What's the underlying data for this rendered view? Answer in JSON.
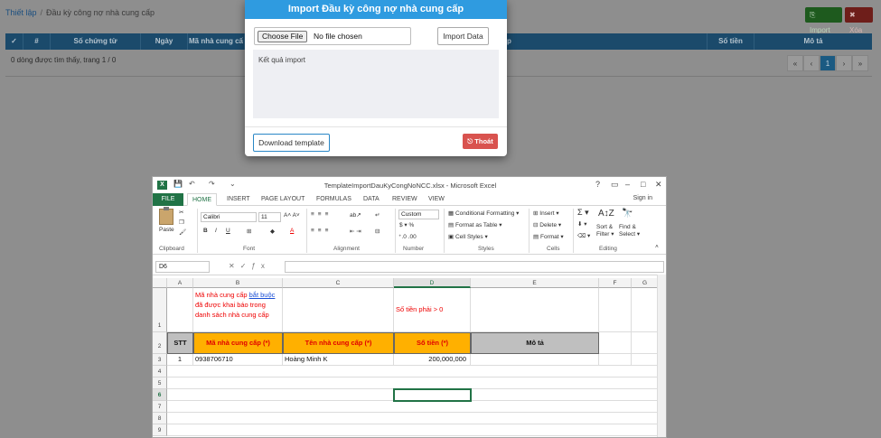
{
  "page": {
    "breadcrumb": {
      "root": "Thiết lập",
      "current": "Đầu kỳ công nợ nhà cung cấp"
    },
    "buttons": {
      "import": "Import",
      "delete": "Xóa"
    },
    "grid": {
      "columns": [
        "✓",
        "#",
        "Số chứng từ",
        "Ngày",
        "Mã nhà cung cấ",
        "p",
        "Số tiền",
        "Mô tả"
      ],
      "status": "0 dòng được tìm thấy, trang 1 / 0",
      "pager": [
        "«",
        "‹",
        "1",
        "›",
        "»"
      ]
    }
  },
  "modal": {
    "title": "Import Đầu kỳ công nợ nhà cung cấp",
    "choose_file": "Choose File",
    "no_file": "No file chosen",
    "import_data": "Import Data",
    "result_label": "Kết quả import",
    "download_template": "Download template",
    "exit": "Thoát"
  },
  "excel": {
    "title": "TemplateImportDauKyCongNoNCC.xlsx - Microsoft Excel",
    "tabs": [
      "FILE",
      "HOME",
      "INSERT",
      "PAGE LAYOUT",
      "FORMULAS",
      "DATA",
      "REVIEW",
      "VIEW"
    ],
    "signin": "Sign in",
    "ribbon": {
      "paste": "Paste",
      "font": "Calibri",
      "size": "11",
      "number_format": "Custom",
      "cond_format": "Conditional Formatting",
      "format_table": "Format as Table",
      "cell_styles": "Cell Styles",
      "insert": "Insert",
      "delete": "Delete",
      "format": "Format",
      "sort": "Sort &",
      "filter": "Filter",
      "find": "Find &",
      "select": "Select",
      "groups": [
        "Clipboard",
        "Font",
        "Alignment",
        "Number",
        "Styles",
        "Cells",
        "Editing"
      ]
    },
    "name_box": "D6",
    "columns": [
      "A",
      "B",
      "C",
      "D",
      "E",
      "F",
      "G"
    ],
    "rows": [
      "1",
      "2",
      "3",
      "4",
      "5",
      "6",
      "7",
      "8",
      "9"
    ],
    "note_b1_pre": "Mã nhà cung cấp ",
    "note_b1_link": "bắt buộc",
    "note_b1_post": "đã được khai báo trong danh sách nhà cung cấp",
    "note_d1": "Số tiền phải > 0",
    "headers": [
      "STT",
      "Mã nhà cung cấp (*)",
      "Tên nhà cung cấp (*)",
      "Số tiền (*)",
      "Mô tả"
    ],
    "row3": [
      "1",
      "0938706710",
      "Hoàng Minh K",
      "200,000,000",
      ""
    ]
  }
}
